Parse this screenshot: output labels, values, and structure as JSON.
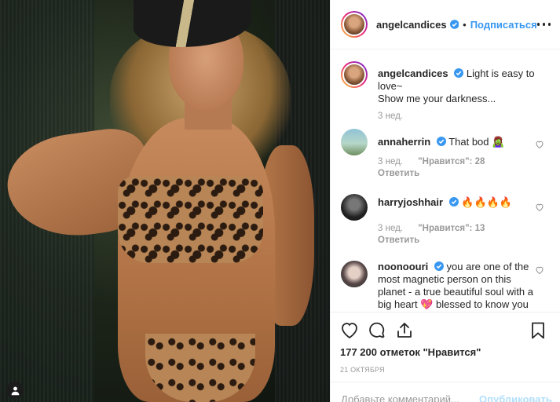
{
  "post": {
    "username": "angelcandices",
    "follow_label": "Подписаться",
    "separator": "•"
  },
  "caption": {
    "username": "angelcandices",
    "text_line1": "Light is easy to love~",
    "text_line2": "Show me your darkness...",
    "time": "3 нед."
  },
  "comments": [
    {
      "username": "annaherrin",
      "text": "That bod 🧟‍♀️",
      "time": "3 нед.",
      "likes": "\"Нравится\": 28",
      "reply": "Ответить"
    },
    {
      "username": "harryjoshhair",
      "text": "🔥🔥🔥🔥",
      "time": "3 нед.",
      "likes": "\"Нравится\": 13",
      "reply": "Ответить"
    },
    {
      "username": "noonoouri",
      "text": "you are one of the most magnetic person on this planet - a true beautiful soul with a big heart 💖 blessed to know you my love"
    }
  ],
  "footer": {
    "likes_total": "177 200 отметок \"Нравится\"",
    "date": "21 ОКТЯБРЯ",
    "comment_placeholder": "Добавьте комментарий...",
    "publish_label": "Опубликовать"
  },
  "icons": {
    "verified": "verified-badge-icon",
    "more": "more-options-icon",
    "like": "heart-icon",
    "comment": "comment-icon",
    "share": "share-icon",
    "save": "bookmark-icon",
    "user_tag": "user-tag-icon"
  },
  "colors": {
    "link": "#3897f0",
    "verified": "#3897f0",
    "publish_disabled": "#b2dffc",
    "muted": "#999999"
  }
}
